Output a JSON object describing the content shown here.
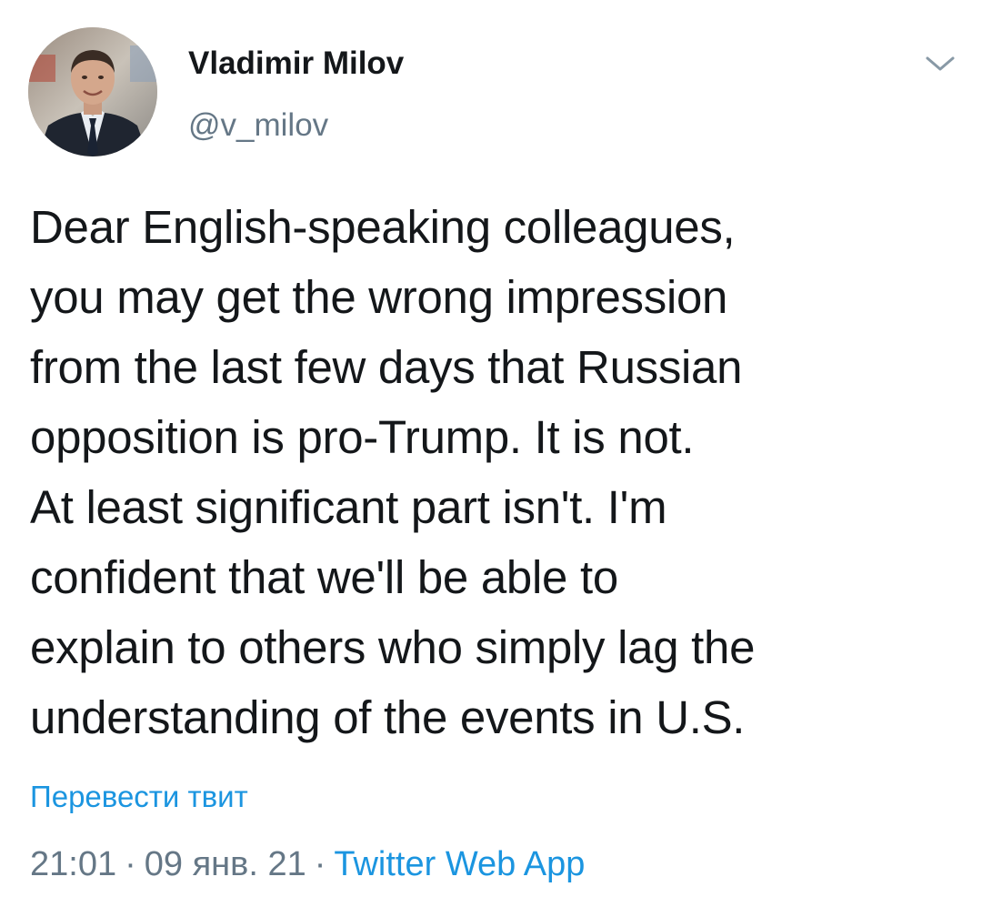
{
  "author": {
    "name": "Vladimir Milov",
    "handle": "@v_milov"
  },
  "tweet": {
    "lines": [
      "Dear English-speaking colleagues,",
      "you may get the wrong impression",
      "from the last few days that Russian",
      "opposition is pro-Trump. It is not.",
      "At least significant part isn't. I'm",
      "confident that we'll be able to",
      "explain to others who simply lag the",
      "understanding of the events in U.S."
    ],
    "translate_label": "Перевести твит"
  },
  "meta": {
    "time": "21:01",
    "separator": "·",
    "date": "09 янв. 21",
    "source": "Twitter Web App"
  },
  "icons": {
    "menu": "chevron-down-icon",
    "avatar": "avatar"
  },
  "colors": {
    "link": "#1b95e0",
    "secondary_text": "#657786",
    "primary_text": "#14171a",
    "background": "#ffffff"
  }
}
